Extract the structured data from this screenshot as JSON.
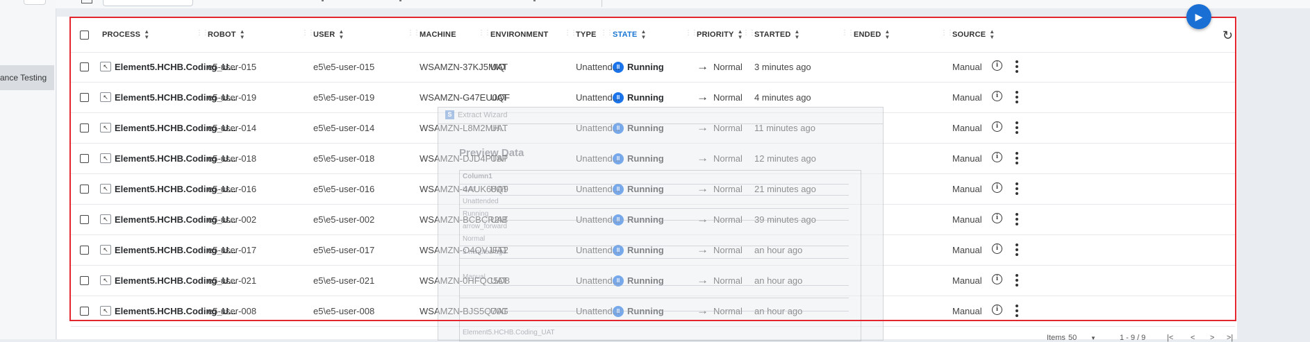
{
  "sidebar": {
    "active_item": "ance Testing"
  },
  "table": {
    "columns": {
      "process": "PROCESS",
      "robot": "ROBOT",
      "user": "USER",
      "machine": "MACHINE",
      "environment": "ENVIRONMENT",
      "type": "TYPE",
      "state": "STATE",
      "priority": "PRIORITY",
      "started": "STARTED",
      "ended": "ENDED",
      "source": "SOURCE"
    },
    "sorted_column": "state",
    "rows": [
      {
        "process": "Element5.HCHB.Coding_U...",
        "robot": "e5-user-015",
        "user": "e5\\e5-user-015",
        "machine": "WSAMZN-37KJ5MIQ",
        "environment": "UAT",
        "type": "Unattend...",
        "state": "Running",
        "priority": "Normal",
        "started": "3 minutes ago",
        "ended": "",
        "source": "Manual"
      },
      {
        "process": "Element5.HCHB.Coding_U...",
        "robot": "e5-user-019",
        "user": "e5\\e5-user-019",
        "machine": "WSAMZN-G47EU0QF",
        "environment": "UAT",
        "type": "Unattend...",
        "state": "Running",
        "priority": "Normal",
        "started": "4 minutes ago",
        "ended": "",
        "source": "Manual"
      },
      {
        "process": "Element5.HCHB.Coding_U...",
        "robot": "e5-user-014",
        "user": "e5\\e5-user-014",
        "machine": "WSAMZN-L8M2MH...",
        "environment": "UAT",
        "type": "Unattend...",
        "state": "Running",
        "priority": "Normal",
        "started": "11 minutes ago",
        "ended": "",
        "source": "Manual"
      },
      {
        "process": "Element5.HCHB.Coding_U...",
        "robot": "e5-user-018",
        "user": "e5\\e5-user-018",
        "machine": "WSAMZN-DJD4PT8P",
        "environment": "UAT",
        "type": "Unattend...",
        "state": "Running",
        "priority": "Normal",
        "started": "12 minutes ago",
        "ended": "",
        "source": "Manual"
      },
      {
        "process": "Element5.HCHB.Coding_U...",
        "robot": "e5-user-016",
        "user": "e5\\e5-user-016",
        "machine": "WSAMZN-4AUK68Q9",
        "environment": "UAT",
        "type": "Unattend...",
        "state": "Running",
        "priority": "Normal",
        "started": "21 minutes ago",
        "ended": "",
        "source": "Manual"
      },
      {
        "process": "Element5.HCHB.Coding_U...",
        "robot": "e5-user-002",
        "user": "e5\\e5-user-002",
        "machine": "WSAMZN-BCBCR2IB",
        "environment": "UAT",
        "type": "Unattend...",
        "state": "Running",
        "priority": "Normal",
        "started": "39 minutes ago",
        "ended": "",
        "source": "Manual"
      },
      {
        "process": "Element5.HCHB.Coding_U...",
        "robot": "e5-user-017",
        "user": "e5\\e5-user-017",
        "machine": "WSAMZN-O4QVJFT2",
        "environment": "UAT",
        "type": "Unattend...",
        "state": "Running",
        "priority": "Normal",
        "started": "an hour ago",
        "ended": "",
        "source": "Manual"
      },
      {
        "process": "Element5.HCHB.Coding_U...",
        "robot": "e5-user-021",
        "user": "e5\\e5-user-021",
        "machine": "WSAMZN-0HFQC5D8",
        "environment": "UAT",
        "type": "Unattend...",
        "state": "Running",
        "priority": "Normal",
        "started": "an hour ago",
        "ended": "",
        "source": "Manual"
      },
      {
        "process": "Element5.HCHB.Coding_U...",
        "robot": "e5-user-008",
        "user": "e5\\e5-user-008",
        "machine": "WSAMZN-BJS5Q70G",
        "environment": "UAT",
        "type": "Unattend...",
        "state": "Running",
        "priority": "Normal",
        "started": "an hour ago",
        "ended": "",
        "source": "Manual"
      }
    ]
  },
  "footer": {
    "items_label": "Items",
    "items_per_page": "50",
    "range": "1 - 9 / 9"
  },
  "overlay": {
    "window_title": "Extract Wizard",
    "heading": "Preview Data",
    "column": "Column1",
    "values": [
      "UAT",
      "Unattended",
      "Running",
      "arrow_forward",
      "Normal",
      "3 minutes ago",
      "Manual",
      "Element5.HCHB.Coding_UAT"
    ]
  },
  "icons": {
    "process": "robot-process-icon",
    "state": "pause-circle-icon",
    "priority": "arrow-forward-icon",
    "info": "info-icon",
    "more": "more-vert-icon",
    "refresh": "refresh-icon",
    "run": "play-icon"
  },
  "colors": {
    "accent": "#1a73e8",
    "highlight_border": "#e3262e"
  }
}
